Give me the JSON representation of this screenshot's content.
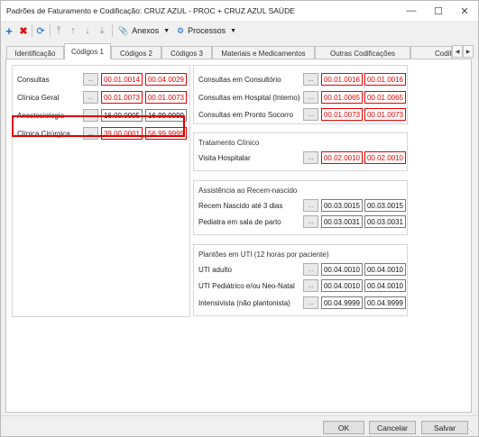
{
  "window": {
    "title": "Padrões de Faturamento e Codificação: CRUZ AZUL - PROC + CRUZ AZUL SAÚDE",
    "controls": [
      "minimize-icon",
      "maximize-icon",
      "close-icon"
    ]
  },
  "toolbar": {
    "icons": [
      "add-icon",
      "delete-icon",
      "refresh-icon",
      "move-top-icon",
      "move-up-icon",
      "move-down-icon",
      "move-bottom-icon"
    ],
    "anexos_label": "Anexos",
    "processos_label": "Processos"
  },
  "tabs": [
    "Identificação",
    "Códigos 1",
    "Códigos 2",
    "Códigos 3",
    "Materiais e Medicamentos",
    "Outras Codificações",
    "Codif"
  ],
  "active_tab": "Códigos 1",
  "left_group": {
    "rows": [
      {
        "label": "Consultas",
        "code1": "00.01.0014",
        "code2": "00.04.0029",
        "style": "red"
      },
      {
        "label": "Clínica Geral",
        "code1": "00.01.0073",
        "code2": "00.01.0073",
        "style": "red"
      },
      {
        "label": "Anestesiologia",
        "code1": "16.00.0005",
        "code2": "16.99.9999",
        "style": "black"
      },
      {
        "label": "Clínica Cirúrgica",
        "code1": "39.00.0001",
        "code2": "56.99.9999",
        "style": "red"
      }
    ],
    "highlighted_row": "Clínica Cirúrgica"
  },
  "consult_group": {
    "rows": [
      {
        "label": "Consultas em Consultório",
        "code1": "00.01.0016",
        "code2": "00.01.0016",
        "style": "red"
      },
      {
        "label": "Consultas em Hospital (Interno)",
        "code1": "00.01.0065",
        "code2": "00.01.0065",
        "style": "red"
      },
      {
        "label": "Consultas em Pronto Socorro",
        "code1": "00.01.0073",
        "code2": "00.01.0073",
        "style": "red"
      }
    ]
  },
  "tratamento_group": {
    "title": "Tratamento Clínico",
    "rows": [
      {
        "label": "Visita Hospitalar",
        "code1": "00.02.0010",
        "code2": "00.02.0010",
        "style": "red"
      }
    ]
  },
  "assistencia_group": {
    "title": "Assistência ao Recem-nascido",
    "rows": [
      {
        "label": "Recem Nascido até 3 dias",
        "code1": "00.03.0015",
        "code2": "00.03.0015",
        "style": "black"
      },
      {
        "label": "Pediatra em sala de parto",
        "code1": "00.03.0031",
        "code2": "00.03.0031",
        "style": "black"
      }
    ]
  },
  "plantoes_group": {
    "title": "Plantões em UTI (12 horas por paciente)",
    "rows": [
      {
        "label": "UTI adulto",
        "code1": "00.04.0010",
        "code2": "00.04.0010",
        "style": "black"
      },
      {
        "label": "UTI Pediátrico e/ou Neo-Natal",
        "code1": "00.04.0010",
        "code2": "00.04.0010",
        "style": "black"
      },
      {
        "label": "Intensivista (não plantonista)",
        "code1": "00.04.9999",
        "code2": "00.04.9999",
        "style": "black"
      }
    ]
  },
  "lookup_button_label": "...",
  "footer": {
    "ok_label": "OK",
    "cancel_label": "Cancelar",
    "save_label": "Salvar"
  }
}
